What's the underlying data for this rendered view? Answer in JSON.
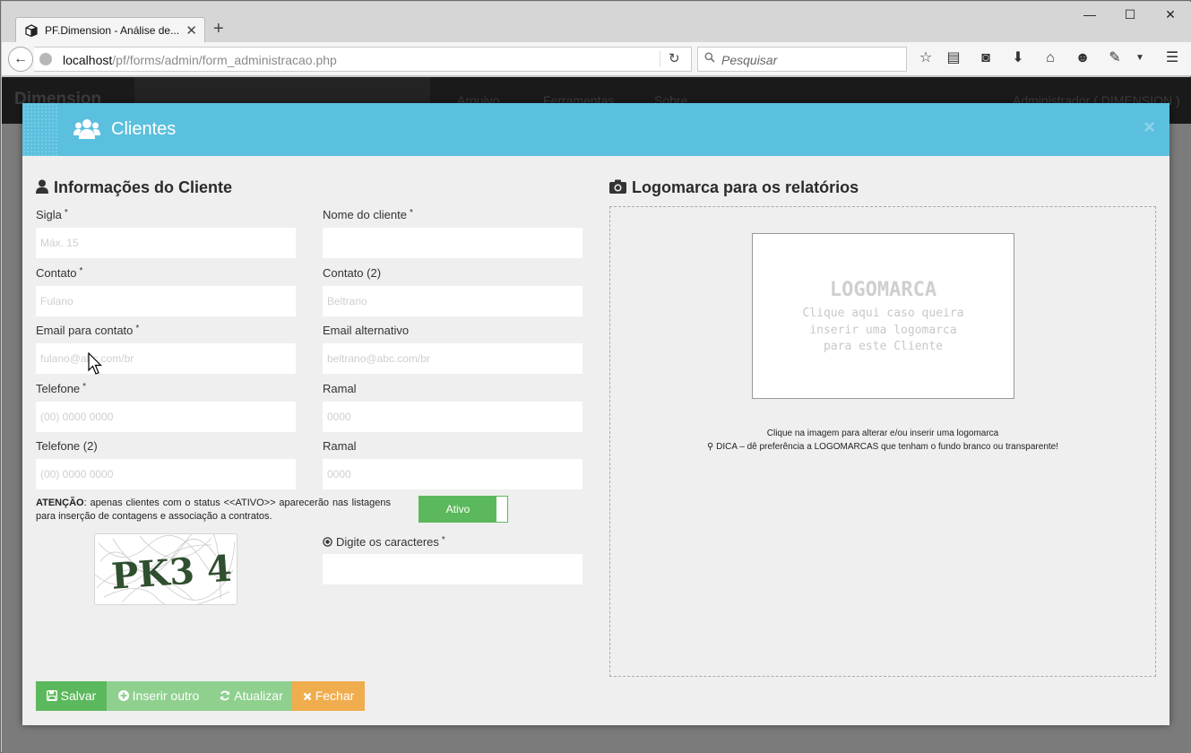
{
  "browser": {
    "tab_title": "PF.Dimension - Análise de...",
    "url_host": "localhost",
    "url_path": "/pf/forms/admin/form_administracao.php",
    "search_placeholder": "Pesquisar"
  },
  "app": {
    "brand": "Dimension",
    "menu": [
      "Arquivo",
      "Ferramentas",
      "Sobre"
    ],
    "user": "Administrador ( DIMENSION )"
  },
  "modal": {
    "title": "Clientes",
    "close_symbol": "×",
    "section_info": "Informações do Cliente",
    "section_logo": "Logomarca para os relatórios"
  },
  "fields": {
    "sigla": {
      "label": "Sigla",
      "required": "*",
      "placeholder": "Máx. 15"
    },
    "nome": {
      "label": "Nome do cliente",
      "required": "*",
      "placeholder": ""
    },
    "contato": {
      "label": "Contato",
      "required": "*",
      "placeholder": "Fulano"
    },
    "contato2": {
      "label": "Contato (2)",
      "placeholder": "Beltrano"
    },
    "email": {
      "label": "Email para contato",
      "required": "*",
      "placeholder": "fulano@abc.com/br"
    },
    "email_alt": {
      "label": "Email alternativo",
      "placeholder": "beltrano@abc.com/br"
    },
    "telefone": {
      "label": "Telefone",
      "required": "*",
      "placeholder": "(00) 0000 0000"
    },
    "ramal": {
      "label": "Ramal",
      "placeholder": "0000"
    },
    "telefone2": {
      "label": "Telefone (2)",
      "placeholder": "(00) 0000 0000"
    },
    "ramal2": {
      "label": "Ramal",
      "placeholder": "0000"
    },
    "captcha": {
      "label": "Digite os caracteres",
      "required": "*",
      "placeholder": ""
    }
  },
  "notice": {
    "strong": "ATENÇÃO",
    "text": ": apenas clientes com o status <<ATIVO>> aparecerão nas listagens para inserção de contagens e associação a contratos."
  },
  "status_toggle": {
    "label": "Ativo",
    "state": "on"
  },
  "captcha_image_text": "PK3 4",
  "logo": {
    "title": "LOGOMARCA",
    "sub1": "Clique aqui caso queira",
    "sub2": "inserir uma logomarca",
    "sub3": "para este Cliente",
    "hint1": "Clique na imagem para alterar e/ou inserir uma logomarca",
    "hint2": "DICA – dê preferência a LOGOMARCAS que tenham o fundo branco ou transparente!"
  },
  "buttons": {
    "salvar": "Salvar",
    "inserir": "Inserir outro",
    "atualizar": "Atualizar",
    "fechar": "Fechar"
  },
  "colors": {
    "header": "#5bc0de",
    "success": "#5cb85c",
    "success_light": "#8fd08f",
    "warning": "#f0ad4e"
  }
}
